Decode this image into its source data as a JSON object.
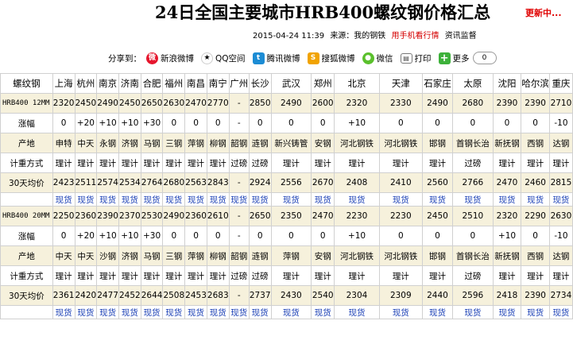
{
  "header": {
    "title": "24日全国主要城市HRB400螺纹钢价格汇总",
    "updating": "更新中..."
  },
  "meta": {
    "datetime": "2015-04-24 11:39",
    "source": "来源：我的钢铁",
    "mobile_link": "用手机看行情",
    "supervision": "资讯监督"
  },
  "share": {
    "label": "分享到：",
    "items": [
      {
        "label": "新浪微博",
        "icon": "sina-weibo-icon"
      },
      {
        "label": "QQ空间",
        "icon": "qq-zone-icon"
      },
      {
        "label": "腾讯微博",
        "icon": "tencent-weibo-icon"
      },
      {
        "label": "搜狐微博",
        "icon": "sohu-weibo-icon"
      },
      {
        "label": "微信",
        "icon": "wechat-icon"
      },
      {
        "label": "打印",
        "icon": "print-icon"
      },
      {
        "label": "更多",
        "icon": "more-icon"
      }
    ],
    "count": "0"
  },
  "table": {
    "header": [
      "螺纹钢",
      "上海",
      "杭州",
      "南京",
      "济南",
      "合肥",
      "福州",
      "南昌",
      "南宁",
      "广州",
      "长沙",
      "武汉",
      "郑州",
      "北京",
      "天津",
      "石家庄",
      "太原",
      "沈阳",
      "哈尔滨",
      "重庆"
    ],
    "link_text": "现货",
    "sections": [
      {
        "name": "HRB400 12MM",
        "rows": [
          {
            "label": "",
            "values": [
              "2320",
              "2450",
              "2490",
              "2450",
              "2650",
              "2630",
              "2470",
              "2770",
              "-",
              "2850",
              "2490",
              "2600",
              "2320",
              "2330",
              "2490",
              "2680",
              "2390",
              "2390",
              "2710"
            ]
          },
          {
            "label": "涨幅",
            "values": [
              "0",
              "+20",
              "+10",
              "+10",
              "+30",
              "0",
              "0",
              "0",
              "-",
              "0",
              "0",
              "0",
              "+10",
              "0",
              "0",
              "0",
              "0",
              "0",
              "-10"
            ]
          },
          {
            "label": "产地",
            "values": [
              "申特",
              "中天",
              "永钢",
              "济钢",
              "马钢",
              "三钢",
              "萍钢",
              "柳钢",
              "韶钢",
              "涟钢",
              "新兴铸管",
              "安钢",
              "河北钢铁",
              "河北钢铁",
              "邯钢",
              "首钢长治",
              "新抚钢",
              "西钢",
              "达钢"
            ]
          },
          {
            "label": "计重方式",
            "values": [
              "理计",
              "理计",
              "理计",
              "理计",
              "理计",
              "理计",
              "理计",
              "理计",
              "过磅",
              "过磅",
              "理计",
              "理计",
              "理计",
              "理计",
              "理计",
              "过磅",
              "理计",
              "理计",
              "理计"
            ]
          },
          {
            "label": "30天均价",
            "values": [
              "2423",
              "2511",
              "2574",
              "2534",
              "2764",
              "2680",
              "2563",
              "2843",
              "-",
              "2924",
              "2556",
              "2670",
              "2408",
              "2410",
              "2560",
              "2766",
              "2470",
              "2460",
              "2815"
            ]
          }
        ]
      },
      {
        "name": "HRB400 20MM",
        "rows": [
          {
            "label": "",
            "values": [
              "2250",
              "2360",
              "2390",
              "2370",
              "2530",
              "2490",
              "2360",
              "2610",
              "-",
              "2650",
              "2350",
              "2470",
              "2230",
              "2230",
              "2450",
              "2510",
              "2320",
              "2290",
              "2630"
            ]
          },
          {
            "label": "涨幅",
            "values": [
              "0",
              "+20",
              "+10",
              "+10",
              "+30",
              "0",
              "0",
              "0",
              "-",
              "0",
              "0",
              "0",
              "+10",
              "0",
              "0",
              "0",
              "+10",
              "0",
              "-10"
            ]
          },
          {
            "label": "产地",
            "values": [
              "中天",
              "中天",
              "沙钢",
              "济钢",
              "马钢",
              "三钢",
              "萍钢",
              "柳钢",
              "韶钢",
              "涟钢",
              "萍钢",
              "安钢",
              "河北钢铁",
              "河北钢铁",
              "邯钢",
              "首钢长治",
              "新抚钢",
              "西钢",
              "达钢"
            ]
          },
          {
            "label": "计重方式",
            "values": [
              "理计",
              "理计",
              "理计",
              "理计",
              "理计",
              "理计",
              "理计",
              "理计",
              "过磅",
              "过磅",
              "理计",
              "理计",
              "理计",
              "理计",
              "理计",
              "过磅",
              "理计",
              "理计",
              "理计"
            ]
          },
          {
            "label": "30天均价",
            "values": [
              "2361",
              "2420",
              "2477",
              "2452",
              "2644",
              "2508",
              "2453",
              "2683",
              "-",
              "2737",
              "2430",
              "2540",
              "2304",
              "2309",
              "2440",
              "2596",
              "2418",
              "2390",
              "2734"
            ]
          }
        ]
      }
    ]
  }
}
